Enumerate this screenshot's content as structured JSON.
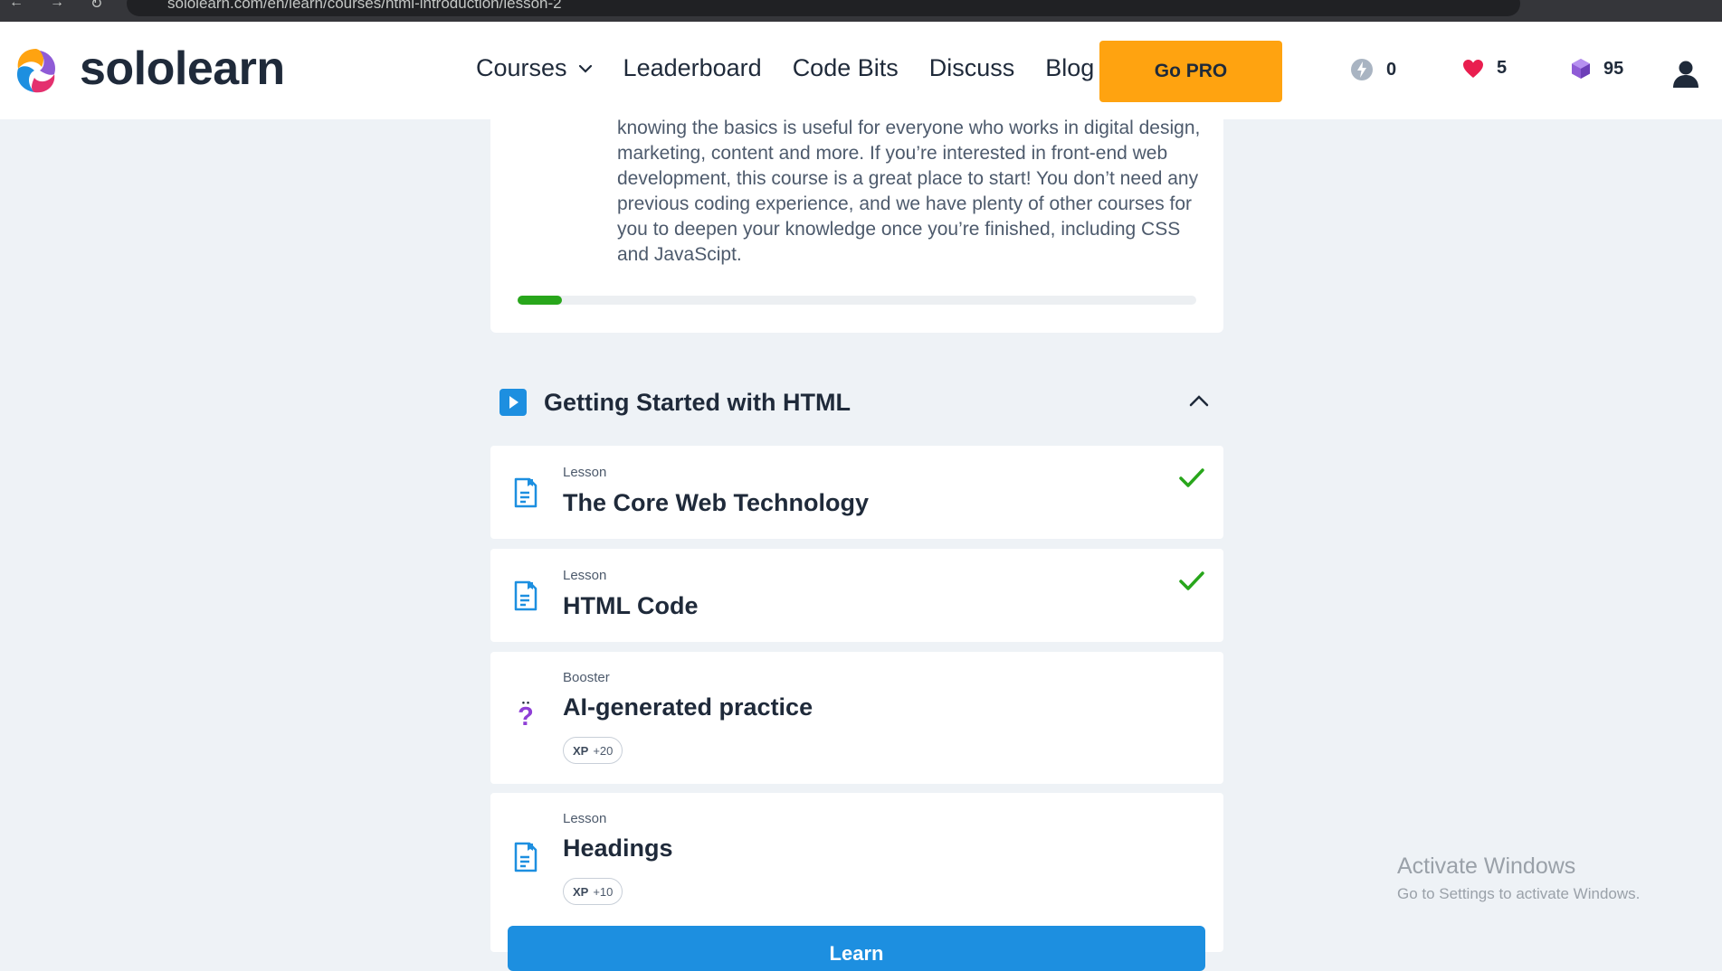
{
  "browser": {
    "url": "sololearn.com/en/learn/courses/html-introduction/lesson-2"
  },
  "header": {
    "brand": "sololearn",
    "nav": [
      {
        "label": "Courses"
      },
      {
        "label": "Leaderboard"
      },
      {
        "label": "Code Bits"
      },
      {
        "label": "Discuss"
      },
      {
        "label": "Blog"
      }
    ],
    "go_pro_label": "Go PRO",
    "stats": {
      "streak": "0",
      "hearts": "5",
      "gems": "95"
    }
  },
  "course": {
    "description": "knowing the basics is useful for everyone who works in digital design, marketing, content and more. If you’re interested in front-end web development, this course is a great place to start! You don’t need any previous coding experience, and we have plenty of other courses for you to deepen your knowledge once you’re finished, including CSS and JavaScipt.",
    "progress_fraction": 0.065
  },
  "section": {
    "title": "Getting Started with HTML",
    "items": [
      {
        "type": "Lesson",
        "title": "The Core Web Technology",
        "completed": true
      },
      {
        "type": "Lesson",
        "title": "HTML Code",
        "completed": true
      },
      {
        "type": "Booster",
        "title": "AI-generated practice",
        "xp_label": "XP",
        "xp_value": "+20"
      },
      {
        "type": "Lesson",
        "title": "Headings",
        "xp_label": "XP",
        "xp_value": "+10"
      }
    ],
    "learn_button_label": "Learn"
  },
  "watermark": {
    "title": "Activate Windows",
    "subtitle": "Go to Settings to activate Windows."
  },
  "colors": {
    "brand_orange": "#ffa310",
    "progress_green": "#28a61b",
    "primary_blue": "#1d8fe0",
    "check_green": "#28a61b",
    "heart_red": "#e91e4f",
    "gem_purple": "#8f5bd6"
  }
}
